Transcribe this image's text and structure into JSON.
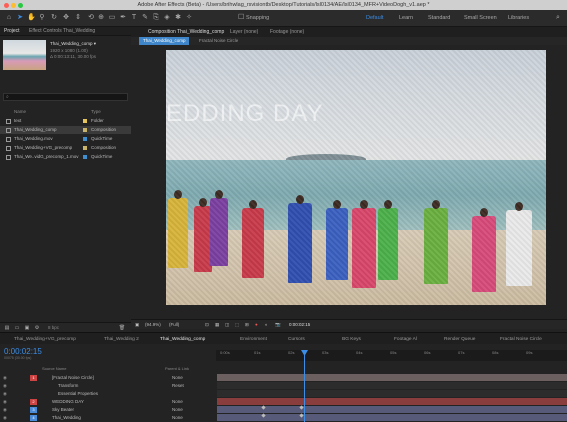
{
  "titlebar": {
    "text": "Adobe After Effects (Beta) - /Users/brihwlag_rsvisiontb/Desktop/Tutorials/lsl0134/AE/lsl0134_MFR+VideoDogh_v1.aep *"
  },
  "toolbar": {
    "snapping": "Snapping",
    "workspaces": [
      "Default",
      "Learn",
      "Standard",
      "Small Screen",
      "Libraries"
    ],
    "active_workspace": "Default"
  },
  "project": {
    "tab_project": "Project",
    "tab_effects": "Effect Controls Thai_Wedding",
    "comp_name": "Thai_Wedding_comp ▾",
    "info1": "1920 x 1080 (1.00)",
    "info2": "Δ 0:00:13:11, 30.00 fps",
    "search_placeholder": "⌕",
    "col_name": "Name",
    "col_type": "Type",
    "items": [
      {
        "name": "text",
        "type": "Folder",
        "color": "#e6c65c"
      },
      {
        "name": "Thai_Wedding_comp",
        "type": "Composition",
        "color": "#c9b46c",
        "selected": true
      },
      {
        "name": "Thai_Wedding.mov",
        "type": "QuickTime",
        "color": "#3f8fd0"
      },
      {
        "name": "Thai_Wedding+VG_precomp",
        "type": "Composition",
        "color": "#c9b46c"
      },
      {
        "name": "Thai_We..vidG_precomp_1.mov",
        "type": "QuickTime",
        "color": "#3f8fd0"
      }
    ],
    "footer_bpc": "8 bpc"
  },
  "composition": {
    "tab_comp": "Composition  Thai_Wedding_comp",
    "tab_layer": "Layer (none)",
    "tab_footage": "Footage (none)",
    "subtab1": "Thai_Wedding_comp",
    "subtab2": "Fractal Noise Circle",
    "overlay_text": "EDDING DAY",
    "zoom": "(94.9%)",
    "quality": "(Full)",
    "timecode": "0:00:02:15"
  },
  "bottom_tabs": [
    "Thai_Wedding+VG_precomp",
    "Thai_Wedding 2",
    "Thai_Wedding_comp",
    "Environment",
    "Cursors",
    "BG Keys",
    "Footage Al",
    "Render Queue",
    "Fractal Noise Circle"
  ],
  "active_bottom_tab": "Thai_Wedding_comp",
  "timeline": {
    "timecode": "0:00:02:15",
    "fps": "00075 (30.00 fps)",
    "ruler": [
      "0:00s",
      "01s",
      "02s",
      "03s",
      "04s",
      "05s",
      "06s",
      "07s",
      "08s",
      "09s"
    ],
    "col_source": "Source Name",
    "col_parent": "Parent & Link",
    "layers": [
      {
        "num": "1",
        "name": "[Fractal Noise Circle]",
        "mode": "None",
        "color": "#c44",
        "bar": "#6b5f5f"
      },
      {
        "num": "",
        "name": "Transform",
        "mode": "Reset",
        "color": "",
        "bar": "#2c2c2c"
      },
      {
        "num": "",
        "name": "Essential Properties",
        "mode": "",
        "color": "",
        "bar": "#2c2c2c"
      },
      {
        "num": "2",
        "name": "WEDDING DAY",
        "mode": "None",
        "color": "#c44",
        "bar": "#8a3d3d"
      },
      {
        "num": "3",
        "name": "Sky Beater",
        "mode": "None",
        "color": "#4a8ad6",
        "bar": "#575a78"
      },
      {
        "num": "4",
        "name": "Thai_Wedding",
        "mode": "None",
        "color": "#4a8ad6",
        "bar": "#575a78"
      }
    ]
  }
}
